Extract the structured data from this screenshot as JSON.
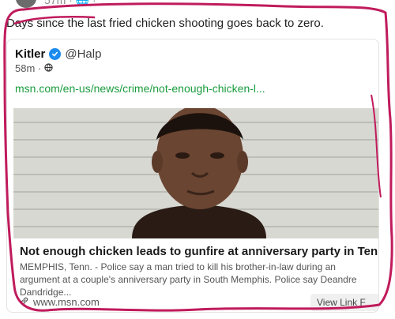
{
  "top": {
    "meta": "57m · 🌐 ·"
  },
  "post": {
    "text": "Days since the last fried chicken shooting goes back to zero."
  },
  "quote": {
    "name": "Kitler",
    "handle": "@Halp",
    "time": "58m ·",
    "link": "msn.com/en-us/news/crime/not-enough-chicken-l..."
  },
  "article": {
    "title": "Not enough chicken leads to gunfire at anniversary party in Tennessee",
    "description": "MEMPHIS, Tenn. - Police say a man tried to kill his brother-in-law during an argument at a couple's anniversary party in South Memphis. Police say Deandre Dandridge...",
    "source": "www.msn.com",
    "view_link": "View Link F"
  },
  "colors": {
    "link_green": "#1a9c3e",
    "verified_blue": "#1d8cf0",
    "annotation_magenta": "#c01b5c"
  }
}
